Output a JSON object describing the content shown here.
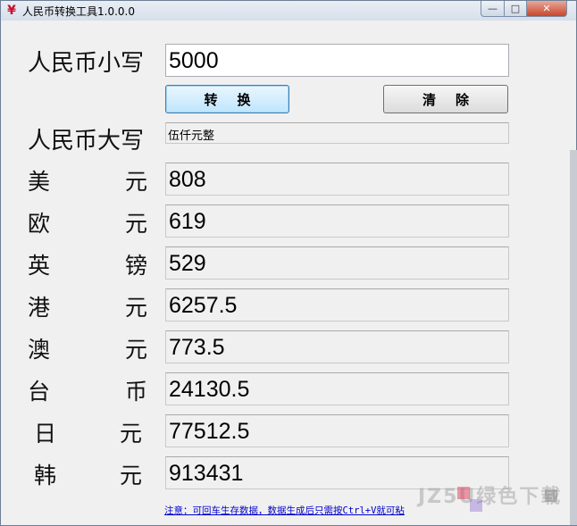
{
  "window": {
    "title": "人民币转换工具1.0.0.0",
    "icon": "yuan-icon",
    "icon_glyph": "¥",
    "controls": {
      "minimize": "—",
      "maximize": "□",
      "close": "✕"
    }
  },
  "rmb_lower": {
    "label": "人民币小写",
    "value": "5000"
  },
  "buttons": {
    "convert": "转换",
    "clear": "清除"
  },
  "rmb_upper": {
    "label": "人民币大写",
    "value": "伍仟元整"
  },
  "currencies": [
    {
      "char1": "美",
      "char2": "元",
      "value": "808"
    },
    {
      "char1": "欧",
      "char2": "元",
      "value": "619"
    },
    {
      "char1": "英",
      "char2": "镑",
      "value": "529"
    },
    {
      "char1": "港",
      "char2": "元",
      "value": "6257.5"
    },
    {
      "char1": "澳",
      "char2": "元",
      "value": "773.5"
    },
    {
      "char1": "台",
      "char2": "币",
      "value": "24130.5"
    },
    {
      "char1": "日",
      "char2": "元",
      "value": "77512.5"
    },
    {
      "char1": "韩",
      "char2": "元",
      "value": "913431"
    }
  ],
  "notice": "注意：可回车生存数据，数据生成后只需按Ctrl+V就可粘",
  "watermark": "JZ5U绿色下载"
}
